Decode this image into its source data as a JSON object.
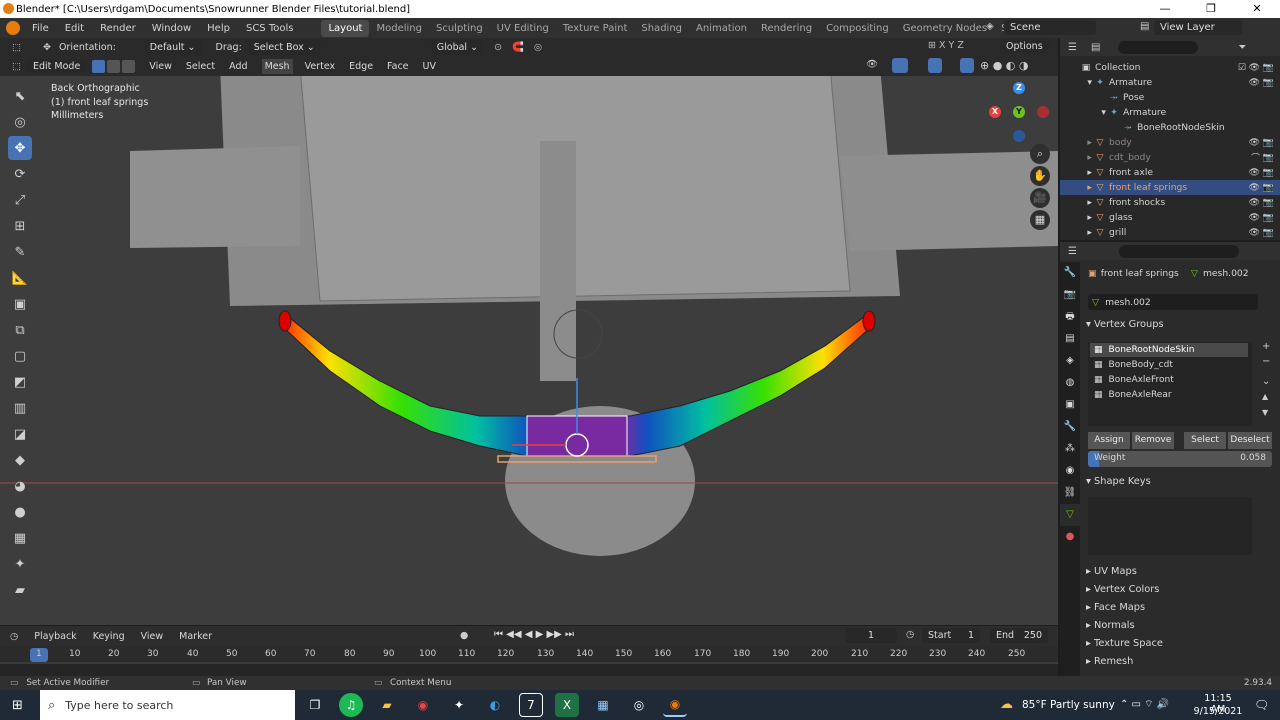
{
  "window": {
    "title": "Blender* [C:\\Users\\rdgam\\Documents\\Snowrunner Blender Files\\tutorial.blend]",
    "min": "—",
    "max": "❐",
    "close": "✕"
  },
  "menu": [
    "File",
    "Edit",
    "Render",
    "Window",
    "Help",
    "SCS Tools"
  ],
  "workspaces": [
    "Layout",
    "Modeling",
    "Sculpting",
    "UV Editing",
    "Texture Paint",
    "Shading",
    "Animation",
    "Rendering",
    "Compositing",
    "Geometry Nodes",
    "Scripting"
  ],
  "add_workspace": "+",
  "scene": {
    "label": "Scene",
    "view_layer": "View Layer"
  },
  "header": {
    "orientation_label": "Orientation:",
    "orientation_value": "Default",
    "drag_label": "Drag:",
    "drag_value": "Select Box",
    "transform": "Global",
    "options": "Options"
  },
  "editbar": {
    "mode": "Edit Mode",
    "menus": [
      "View",
      "Select",
      "Add",
      "Mesh",
      "Vertex",
      "Edge",
      "Face",
      "UV"
    ]
  },
  "viewport": {
    "view_name": "Back Orthographic",
    "object": "(1) front leaf springs",
    "units": "Millimeters"
  },
  "gizmo": {
    "z": "Z",
    "y": "Y",
    "x": "X"
  },
  "outliner": {
    "root": "Collection",
    "items": [
      {
        "label": "Armature",
        "type": "armature",
        "depth": 1
      },
      {
        "label": "Pose",
        "type": "pose",
        "depth": 2
      },
      {
        "label": "Armature",
        "type": "armdata",
        "depth": 2
      },
      {
        "label": "BoneRootNodeSkin",
        "type": "bone",
        "depth": 3
      },
      {
        "label": "body",
        "type": "mesh",
        "depth": 1,
        "dim": true
      },
      {
        "label": "cdt_body",
        "type": "mesh",
        "depth": 1,
        "dim": true
      },
      {
        "label": "front axle",
        "type": "mesh",
        "depth": 1
      },
      {
        "label": "front leaf springs",
        "type": "mesh",
        "depth": 1,
        "selected": true
      },
      {
        "label": "front shocks",
        "type": "mesh",
        "depth": 1
      },
      {
        "label": "glass",
        "type": "mesh",
        "depth": 1
      },
      {
        "label": "grill",
        "type": "mesh",
        "depth": 1
      }
    ]
  },
  "properties": {
    "object": "front leaf springs",
    "mesh": "mesh.002",
    "mesh_field": "mesh.002",
    "vertex_groups_title": "Vertex Groups",
    "vertex_groups": [
      "BoneRootNodeSkin",
      "BoneBody_cdt",
      "BoneAxleFront",
      "BoneAxleRear"
    ],
    "buttons": {
      "assign": "Assign",
      "remove": "Remove",
      "select": "Select",
      "deselect": "Deselect"
    },
    "weight_label": "Weight",
    "weight_value": "0.058",
    "weight_fraction": 0.058,
    "shape_keys": "Shape Keys",
    "collapsed": [
      "UV Maps",
      "Vertex Colors",
      "Face Maps",
      "Normals",
      "Texture Space",
      "Remesh"
    ]
  },
  "timeline": {
    "menus": [
      "Playback",
      "Keying",
      "View",
      "Marker"
    ],
    "current": "1",
    "start_label": "Start",
    "start": "1",
    "end_label": "End",
    "end": "250",
    "ticks": [
      "1",
      "10",
      "20",
      "30",
      "40",
      "50",
      "60",
      "70",
      "80",
      "90",
      "100",
      "110",
      "120",
      "130",
      "140",
      "150",
      "160",
      "170",
      "180",
      "190",
      "200",
      "210",
      "220",
      "230",
      "240",
      "250"
    ]
  },
  "status": {
    "left": "Set Active Modifier",
    "mid": "Pan View",
    "right": "Context Menu",
    "version": "2.93.4"
  },
  "taskbar": {
    "search": "Type here to search",
    "weather": "85°F  Partly sunny",
    "time": "11:15 AM",
    "date": "9/15/2021"
  }
}
